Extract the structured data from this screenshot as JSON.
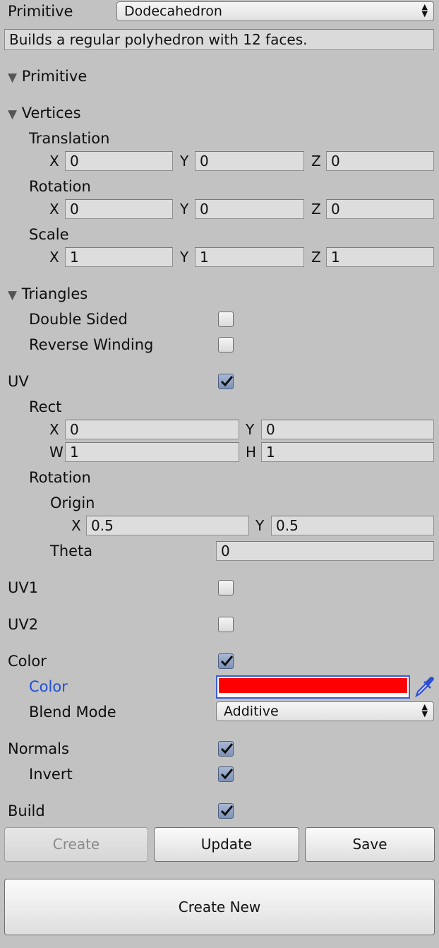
{
  "header": {
    "primitive_label": "Primitive",
    "primitive_value": "Dodecahedron",
    "description": "Builds a regular polyhedron with 12 faces."
  },
  "sections": {
    "primitive": "Primitive",
    "vertices": "Vertices",
    "triangles": "Triangles"
  },
  "vertices": {
    "translation": {
      "label": "Translation",
      "x": "0",
      "y": "0",
      "z": "0"
    },
    "rotation": {
      "label": "Rotation",
      "x": "0",
      "y": "0",
      "z": "0"
    },
    "scale": {
      "label": "Scale",
      "x": "1",
      "y": "1",
      "z": "1"
    }
  },
  "axes": {
    "x": "X",
    "y": "Y",
    "z": "Z",
    "w": "W",
    "h": "H"
  },
  "triangles": {
    "double_sided_label": "Double Sided",
    "double_sided": false,
    "reverse_winding_label": "Reverse Winding",
    "reverse_winding": false
  },
  "uv": {
    "label": "UV",
    "enabled": true,
    "rect_label": "Rect",
    "rect": {
      "x": "0",
      "y": "0",
      "w": "1",
      "h": "1"
    },
    "rotation_label": "Rotation",
    "origin_label": "Origin",
    "origin": {
      "x": "0.5",
      "y": "0.5"
    },
    "theta_label": "Theta",
    "theta": "0"
  },
  "uv1": {
    "label": "UV1",
    "enabled": false
  },
  "uv2": {
    "label": "UV2",
    "enabled": false
  },
  "color": {
    "label": "Color",
    "enabled": true,
    "color_label": "Color",
    "swatch": "#ff0000",
    "label_color": "#1f4fd8",
    "blend_mode_label": "Blend Mode",
    "blend_mode": "Additive",
    "picker_icon": "eyedropper-icon"
  },
  "normals": {
    "label": "Normals",
    "enabled": true,
    "invert_label": "Invert",
    "invert": true
  },
  "build": {
    "label": "Build",
    "enabled": true
  },
  "buttons": {
    "create": "Create",
    "update": "Update",
    "save": "Save",
    "create_new": "Create New"
  }
}
